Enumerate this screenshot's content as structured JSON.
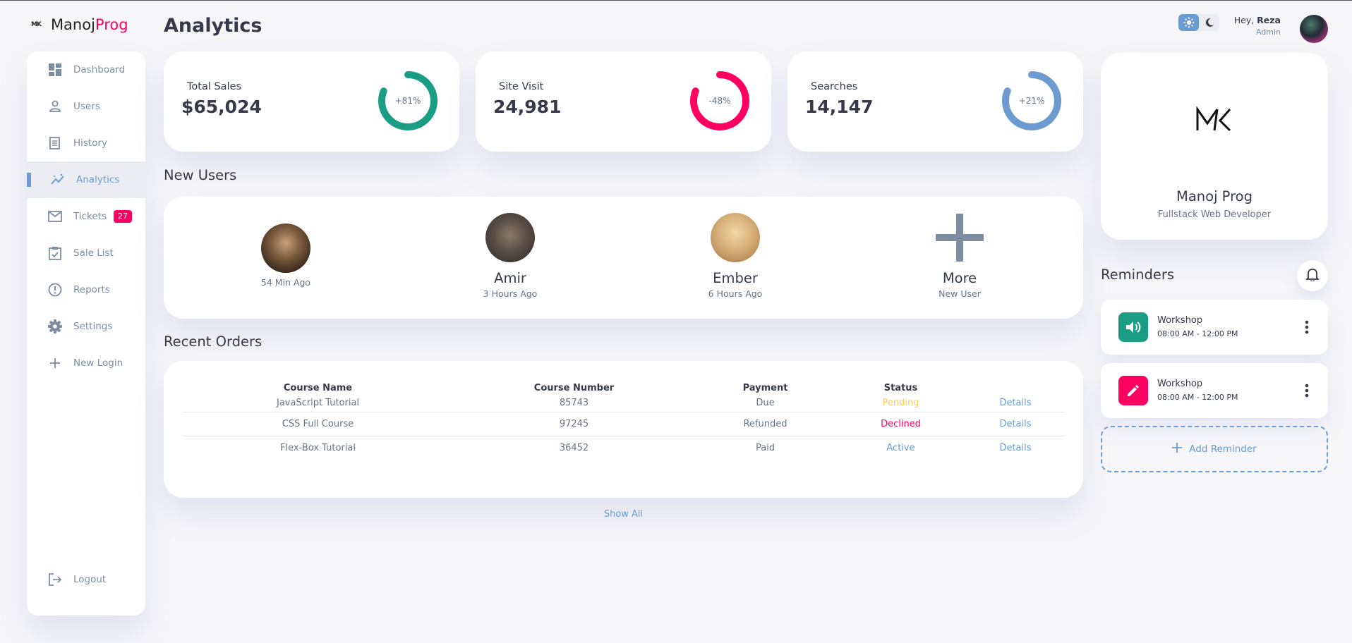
{
  "brand": {
    "logo_mark": "MK",
    "name_main": "Manoj",
    "name_accent": "Prog"
  },
  "page": {
    "title": "Analytics"
  },
  "sidebar": {
    "items": [
      {
        "label": "Dashboard",
        "icon": "dashboard-icon"
      },
      {
        "label": "Users",
        "icon": "person-icon"
      },
      {
        "label": "History",
        "icon": "receipt-icon"
      },
      {
        "label": "Analytics",
        "icon": "insights-icon",
        "active": true
      },
      {
        "label": "Tickets",
        "icon": "mail-icon",
        "badge": "27"
      },
      {
        "label": "Sale List",
        "icon": "clipboard-check-icon"
      },
      {
        "label": "Reports",
        "icon": "report-icon"
      },
      {
        "label": "Settings",
        "icon": "gear-icon"
      },
      {
        "label": "New Login",
        "icon": "plus-icon"
      }
    ],
    "logout": {
      "label": "Logout",
      "icon": "logout-icon"
    }
  },
  "header": {
    "greeting": "Hey, ",
    "user_name": "Reza",
    "user_role": "Admin",
    "theme": "light"
  },
  "stats": [
    {
      "label": "Total Sales",
      "value": "$65,024",
      "percent_text": "+81%",
      "progress": 0.81,
      "color": "#1b9c85"
    },
    {
      "label": "Site Visit",
      "value": "24,981",
      "percent_text": "-48%",
      "progress": 0.81,
      "color": "#ff0060"
    },
    {
      "label": "Searches",
      "value": "14,147",
      "percent_text": "+21%",
      "progress": 0.81,
      "color": "#6c9bcf"
    }
  ],
  "new_users": {
    "title": "New Users",
    "users": [
      {
        "name": "",
        "time": "54 Min Ago"
      },
      {
        "name": "Amir",
        "time": "3 Hours Ago"
      },
      {
        "name": "Ember",
        "time": "6 Hours Ago"
      },
      {
        "name": "More",
        "time": "New User"
      }
    ]
  },
  "orders": {
    "title": "Recent Orders",
    "columns": [
      "Course Name",
      "Course Number",
      "Payment",
      "Status",
      ""
    ],
    "rows": [
      {
        "course": "JavaScript Tutorial",
        "number": "85743",
        "payment": "Due",
        "status": "Pending",
        "action": "Details"
      },
      {
        "course": "CSS Full Course",
        "number": "97245",
        "payment": "Refunded",
        "status": "Declined",
        "action": "Details"
      },
      {
        "course": "Flex-Box Tutorial",
        "number": "36452",
        "payment": "Paid",
        "status": "Active",
        "action": "Details"
      }
    ],
    "show_all": "Show All"
  },
  "profile": {
    "logo_mark": "MK",
    "name": "Manoj Prog",
    "role": "Fullstack Web Developer"
  },
  "reminders": {
    "title": "Reminders",
    "items": [
      {
        "title": "Workshop",
        "time": "08:00 AM - 12:00 PM",
        "icon": "volume-icon",
        "color": "#1b9c85"
      },
      {
        "title": "Workshop",
        "time": "08:00 AM - 12:00 PM",
        "icon": "edit-icon",
        "color": "#ff0060"
      }
    ],
    "add_label": "Add Reminder"
  }
}
